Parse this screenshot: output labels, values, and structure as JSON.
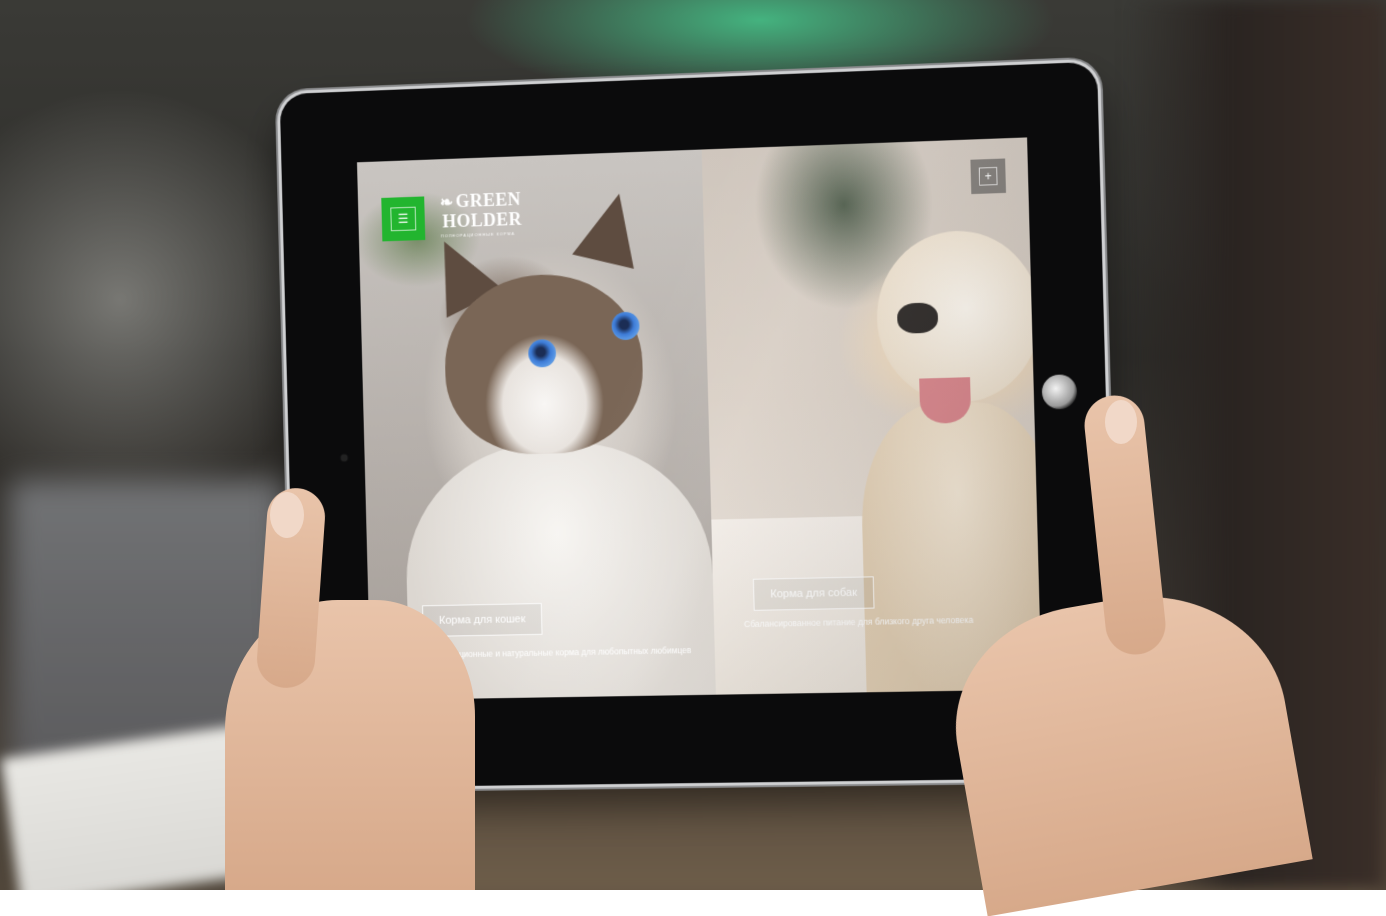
{
  "header": {
    "menu_icon": "hamburger-icon",
    "logo": {
      "line1": "GREEN",
      "line2": "HOLDER",
      "tagline": "ПОЛНОРАЦИОННЫЕ КОРМА",
      "leaf_icon": "leaf-icon"
    },
    "plus_icon": "plus-icon"
  },
  "panels": [
    {
      "id": "cats",
      "button_label": "Корма для кошек",
      "caption": "Полнорационные и натуральные корма  для любопытных любимцев"
    },
    {
      "id": "dogs",
      "button_label": "Корма для собак",
      "caption": "Сбалансированное питание для близкого  друга человека"
    }
  ],
  "colors": {
    "accent_green": "#22b52f",
    "tablet_bezel": "#0b0b0c"
  }
}
